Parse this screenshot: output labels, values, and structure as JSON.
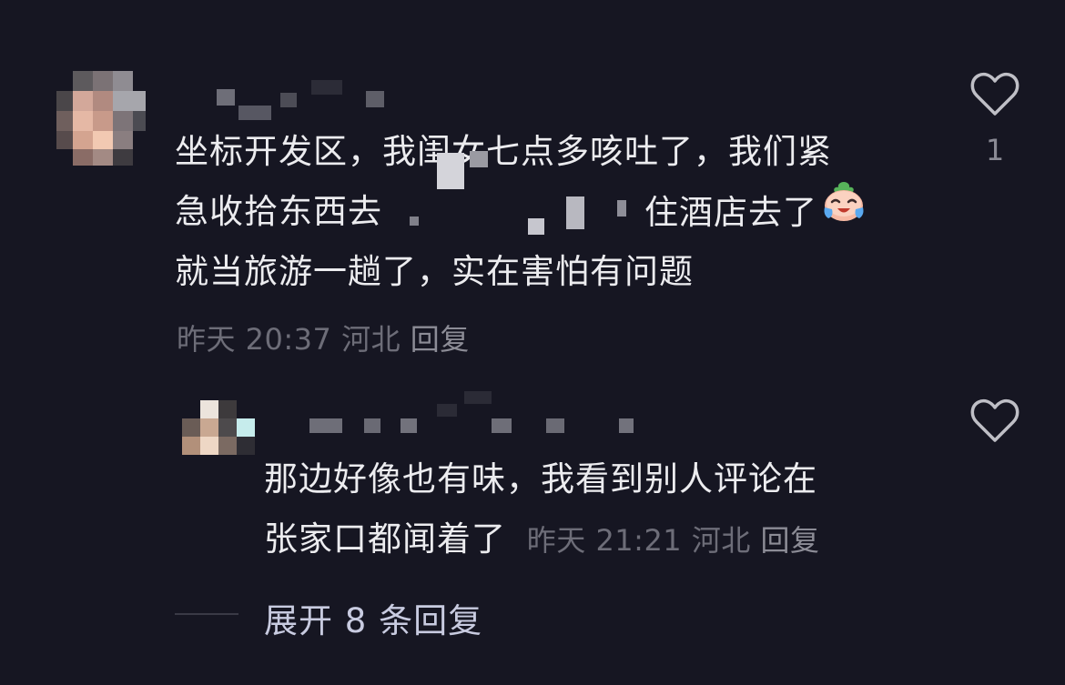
{
  "comments": [
    {
      "lines": [
        "坐标开发区，我闺女七点多咳吐了，我们紧",
        "急收拾东西去",
        "住酒店去了",
        "就当旅游一趟了，实在害怕有问题"
      ],
      "emoji": "crying-laughing-emoji",
      "time": "昨天 20:37",
      "location": "河北",
      "reply_label": "回复",
      "like_count": "1"
    },
    {
      "lines": [
        "那边好像也有味，我看到别人评论在",
        "张家口都闻着了"
      ],
      "time": "昨天 21:21",
      "location": "河北",
      "reply_label": "回复"
    }
  ],
  "expand_replies": "展开 8 条回复",
  "colors": {
    "background": "#161622",
    "text": "#ececef",
    "meta": "#6d6d78",
    "expand": "#c8cbe0"
  }
}
